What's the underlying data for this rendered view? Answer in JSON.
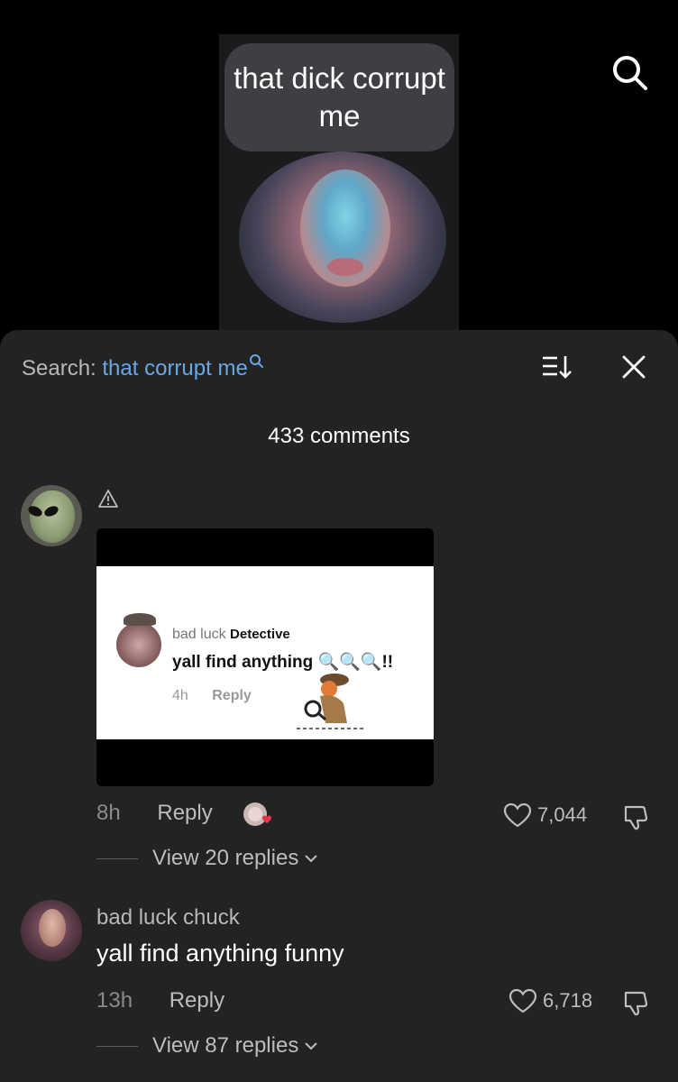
{
  "video": {
    "overlay_text": "that dick corrupt me"
  },
  "sheet": {
    "search_label": "Search:",
    "search_query": "that corrupt me",
    "comment_count": "433 comments"
  },
  "comments": [
    {
      "has_warning": true,
      "attached_media": {
        "author": "bad luck",
        "author_suffix": "Detective",
        "text": "yall find anything 🔍🔍🔍!!",
        "time": "4h",
        "reply": "Reply"
      },
      "time": "8h",
      "reply": "Reply",
      "likes": "7,044",
      "view_replies": "View 20 replies"
    },
    {
      "author": "bad luck chuck",
      "text": "yall find anything funny",
      "time": "13h",
      "reply": "Reply",
      "likes": "6,718",
      "view_replies": "View 87 replies"
    }
  ],
  "colors": {
    "sheet_bg": "#232323",
    "query_link": "#68a7e6",
    "heart_badge": "#e8334a"
  }
}
